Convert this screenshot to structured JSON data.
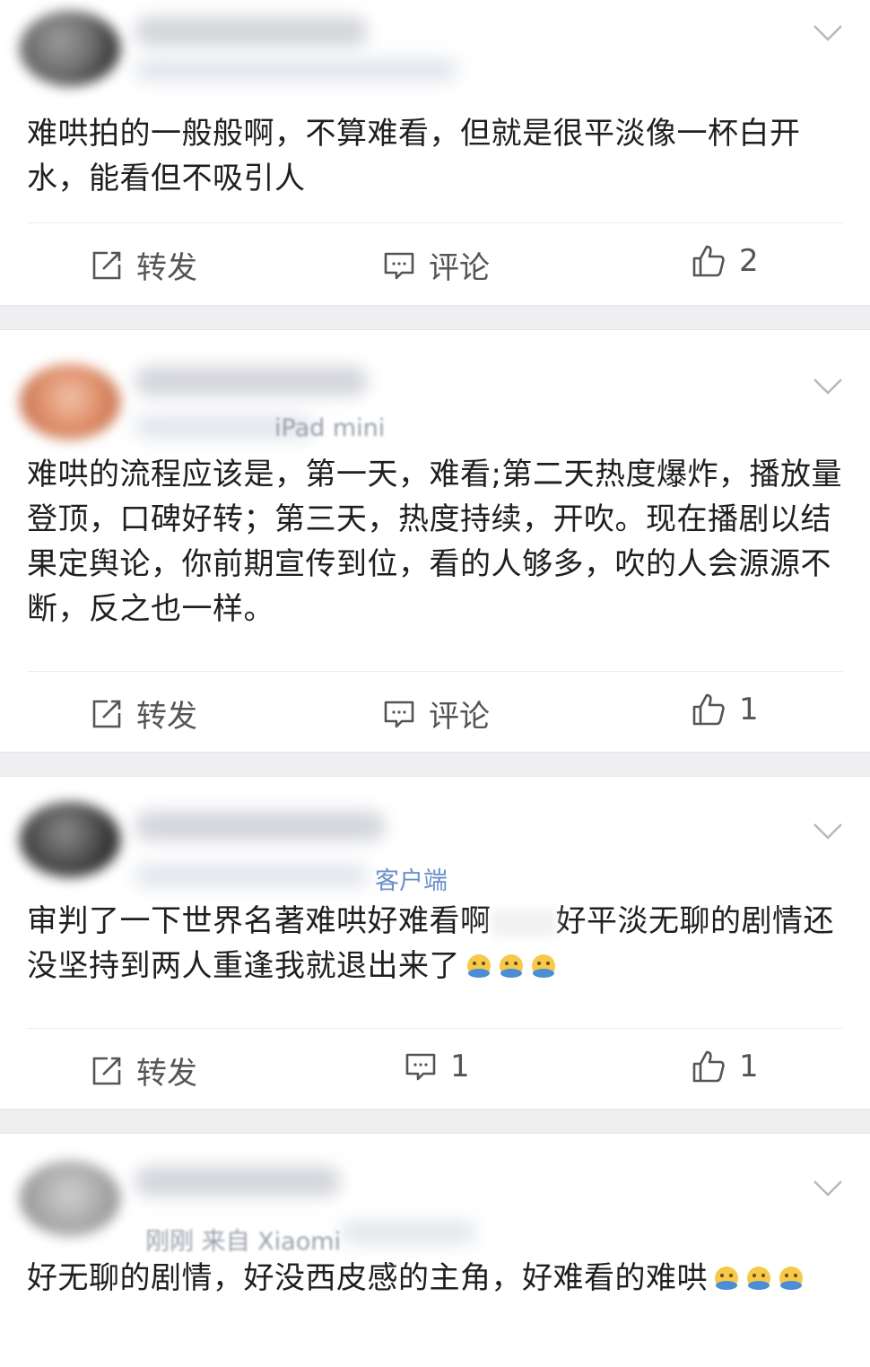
{
  "actions": {
    "repost_label": "转发",
    "comment_label": "评论"
  },
  "posts": [
    {
      "meta_text": "",
      "content": "难哄拍的一般般啊，不算难看，但就是很平淡像一杯白开水，能看但不吸引人",
      "comments": "",
      "likes": "2"
    },
    {
      "meta_text": "iPad mini",
      "content": "难哄的流程应该是，第一天，难看;第二天热度爆炸，播放量登顶，口碑好转；第三天，热度持续，开吹。现在播剧以结果定舆论，你前期宣传到位，看的人够多，吹的人会源源不断，反之也一样。",
      "comments": "",
      "likes": "1"
    },
    {
      "meta_text": "客户端",
      "content_part1": "审判了一下世界名著难哄好难看啊",
      "content_part2": "好平淡无聊的剧情还没坚持到两人重逢我就退出来了",
      "comments": "1",
      "likes": "1"
    },
    {
      "meta_text": "刚刚  来自 Xiaomi",
      "content": "好无聊的剧情，好没西皮感的主角，好难看的难哄",
      "comments": "",
      "likes": ""
    }
  ]
}
